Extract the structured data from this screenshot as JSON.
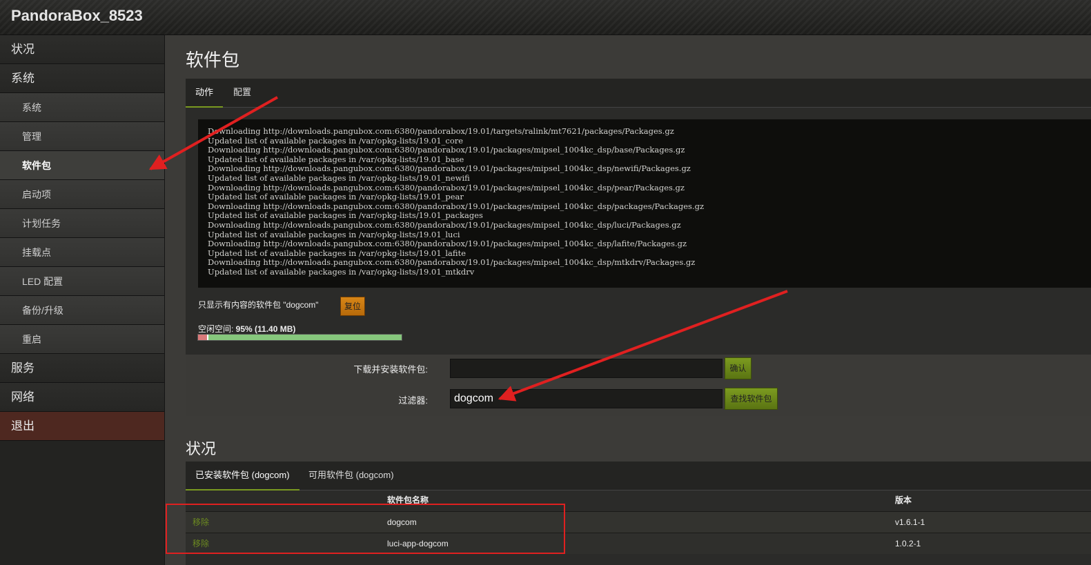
{
  "header": {
    "brand": "PandoraBox_8523"
  },
  "sidebar": {
    "items": [
      {
        "label": "状况"
      },
      {
        "label": "系统"
      },
      {
        "label": "系统"
      },
      {
        "label": "管理"
      },
      {
        "label": "软件包"
      },
      {
        "label": "启动项"
      },
      {
        "label": "计划任务"
      },
      {
        "label": "挂载点"
      },
      {
        "label": "LED 配置"
      },
      {
        "label": "备份/升级"
      },
      {
        "label": "重启"
      },
      {
        "label": "服务"
      },
      {
        "label": "网络"
      },
      {
        "label": "退出"
      }
    ]
  },
  "page": {
    "title": "软件包"
  },
  "tabs": [
    {
      "label": "动作"
    },
    {
      "label": "配置"
    }
  ],
  "log": {
    "lines": [
      "Downloading http://downloads.pangubox.com:6380/pandorabox/19.01/targets/ralink/mt7621/packages/Packages.gz",
      "Updated list of available packages in /var/opkg-lists/19.01_core",
      "Downloading http://downloads.pangubox.com:6380/pandorabox/19.01/packages/mipsel_1004kc_dsp/base/Packages.gz",
      "Updated list of available packages in /var/opkg-lists/19.01_base",
      "Downloading http://downloads.pangubox.com:6380/pandorabox/19.01/packages/mipsel_1004kc_dsp/newifi/Packages.gz",
      "Updated list of available packages in /var/opkg-lists/19.01_newifi",
      "Downloading http://downloads.pangubox.com:6380/pandorabox/19.01/packages/mipsel_1004kc_dsp/pear/Packages.gz",
      "Updated list of available packages in /var/opkg-lists/19.01_pear",
      "Downloading http://downloads.pangubox.com:6380/pandorabox/19.01/packages/mipsel_1004kc_dsp/packages/Packages.gz",
      "Updated list of available packages in /var/opkg-lists/19.01_packages",
      "Downloading http://downloads.pangubox.com:6380/pandorabox/19.01/packages/mipsel_1004kc_dsp/luci/Packages.gz",
      "Updated list of available packages in /var/opkg-lists/19.01_luci",
      "Downloading http://downloads.pangubox.com:6380/pandorabox/19.01/packages/mipsel_1004kc_dsp/lafite/Packages.gz",
      "Updated list of available packages in /var/opkg-lists/19.01_lafite",
      "Downloading http://downloads.pangubox.com:6380/pandorabox/19.01/packages/mipsel_1004kc_dsp/mtkdrv/Packages.gz",
      "Updated list of available packages in /var/opkg-lists/19.01_mtkdrv"
    ]
  },
  "filter_note": "只显示有内容的软件包 \"dogcom\"",
  "reset_label": "复位",
  "space": {
    "label": "空闲空间: ",
    "value": "95% (11.40 MB)",
    "free_fraction": 0.95
  },
  "form": {
    "download_label": "下载并安装软件包:",
    "download_value": "",
    "confirm_label": "确认",
    "filter_label": "过滤器:",
    "filter_value": "dogcom",
    "find_label": "查找软件包"
  },
  "status": {
    "title": "状况"
  },
  "status_tabs": [
    {
      "label": "已安装软件包 (dogcom)"
    },
    {
      "label": "可用软件包 (dogcom)"
    }
  ],
  "table": {
    "headers": {
      "name": "软件包名称",
      "version": "版本"
    },
    "rows": [
      {
        "action": "移除",
        "name": "dogcom",
        "version": "v1.6.1-1"
      },
      {
        "action": "移除",
        "name": "luci-app-dogcom",
        "version": "1.0.2-1"
      }
    ]
  },
  "colors": {
    "annotation": "#e02020",
    "accent": "#7a9a20",
    "logout": "#4e2820"
  }
}
